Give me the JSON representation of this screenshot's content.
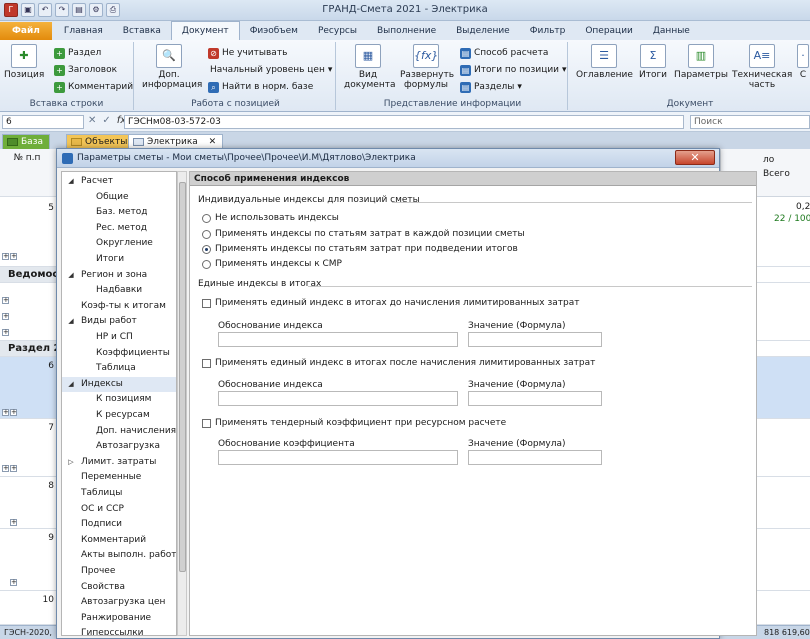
{
  "app": {
    "title": "ГРАНД-Смета 2021 - Электрика"
  },
  "ribbon": {
    "tabs": [
      "Файл",
      "Главная",
      "Вставка",
      "Документ",
      "Фиэобъем",
      "Ресурсы",
      "Выполнение",
      "Выделение",
      "Фильтр",
      "Операции",
      "Данные"
    ],
    "groups": {
      "insert_row": {
        "label": "Вставка строки",
        "position": "Позиция",
        "section": "Раздел",
        "heading": "Заголовок",
        "comment": "Комментарий"
      },
      "work_with_position": {
        "label": "Работа с позицией",
        "add_info": "Доп. информация",
        "ignore": "Не учитывать",
        "start_level": "Начальный уровень цен",
        "find_norm": "Найти в норм. базе"
      },
      "info_view": {
        "label": "Представление информации",
        "view_doc": "Вид документа",
        "expand_formulas": "Развернуть формулы",
        "calc_method": "Способ расчета",
        "totals_by_position": "Итоги по позиции",
        "sections": "Разделы"
      },
      "document": {
        "label": "Документ",
        "contents": "Оглавление",
        "totals": "Итоги",
        "parameters": "Параметры",
        "tech_part": "Техническая часть",
        "extra": "С"
      }
    }
  },
  "formula_bar": {
    "cell_ref": "6",
    "formula": "ГЭСНм08-03-572-03",
    "search_placeholder": "Поиск"
  },
  "doc_tabs": [
    "База",
    "Объекты",
    "Электрика"
  ],
  "sheet": {
    "col_num_header": "№ п.п",
    "col_right_header_1": "ло",
    "col_right_header_2": "Всего",
    "row_5_num": "5",
    "row_5_val1": "0,2",
    "row_5_val2": "22 / 100",
    "section_vedomost": "Ведомост",
    "section_razdel": "Раздел 2",
    "row_6": "6",
    "row_7": "7",
    "row_8": "8",
    "row_9": "9",
    "row_10": "10"
  },
  "status_bar": {
    "left": "ГЭСН-2020, ",
    "right": "818 619,60"
  },
  "dialog": {
    "title": "Параметры сметы - Мои сметы\\Прочее\\Прочее\\И.М\\Дятлово\\Электрика",
    "close": "✕",
    "tree": [
      {
        "label": "Расчет",
        "level": 0,
        "expanded": true
      },
      {
        "label": "Общие",
        "level": 1
      },
      {
        "label": "Баз. метод",
        "level": 1
      },
      {
        "label": "Рес. метод",
        "level": 1
      },
      {
        "label": "Округление",
        "level": 1
      },
      {
        "label": "Итоги",
        "level": 1
      },
      {
        "label": "Регион и зона",
        "level": 0,
        "expanded": true
      },
      {
        "label": "Надбавки",
        "level": 1
      },
      {
        "label": "Коэф-ты к итогам",
        "level": 0
      },
      {
        "label": "Виды работ",
        "level": 0,
        "expanded": true
      },
      {
        "label": "НР и СП",
        "level": 1
      },
      {
        "label": "Коэффициенты",
        "level": 1
      },
      {
        "label": "Таблица",
        "level": 1
      },
      {
        "label": "Индексы",
        "level": 0,
        "expanded": true,
        "selected": true
      },
      {
        "label": "К позициям",
        "level": 1
      },
      {
        "label": "К ресурсам",
        "level": 1
      },
      {
        "label": "Доп. начисления",
        "level": 1
      },
      {
        "label": "Автозагрузка",
        "level": 1
      },
      {
        "label": "Лимит. затраты",
        "level": 0,
        "collapsed": true
      },
      {
        "label": "Переменные",
        "level": 0
      },
      {
        "label": "Таблицы",
        "level": 0
      },
      {
        "label": "ОС и ССР",
        "level": 0
      },
      {
        "label": "Подписи",
        "level": 0
      },
      {
        "label": "Комментарий",
        "level": 0
      },
      {
        "label": "Акты выполн. работ",
        "level": 0
      },
      {
        "label": "Прочее",
        "level": 0
      },
      {
        "label": "Свойства",
        "level": 0
      },
      {
        "label": "Автозагрузка цен",
        "level": 0
      },
      {
        "label": "Ранжирование",
        "level": 0
      },
      {
        "label": "Гиперссылки",
        "level": 0
      }
    ],
    "panel": {
      "header": "Способ применения индексов",
      "individual_title": "Индивидуальные индексы для позиций сметы",
      "radios": [
        {
          "label": "Не использовать индексы",
          "checked": false
        },
        {
          "label": "Применять индексы по статьям затрат в каждой позиции сметы",
          "checked": false
        },
        {
          "label": "Применять индексы по статьям затрат при подведении итогов",
          "checked": true
        },
        {
          "label": "Применять индексы к СМР",
          "checked": false
        }
      ],
      "single_title": "Единые индексы в итогах",
      "blocks": [
        {
          "checkbox": "Применять единый индекс в итогах до начисления лимитированных затрат",
          "justification": "Обоснование индекса",
          "value": "Значение (Формула)"
        },
        {
          "checkbox": "Применять единый индекс в итогах после начисления лимитированных затрат",
          "justification": "Обоснование индекса",
          "value": "Значение (Формула)"
        },
        {
          "checkbox": "Применять тендерный коэффициент при ресурсном расчете",
          "justification": "Обоснование коэффициента",
          "value": "Значение (Формула)"
        }
      ]
    }
  }
}
